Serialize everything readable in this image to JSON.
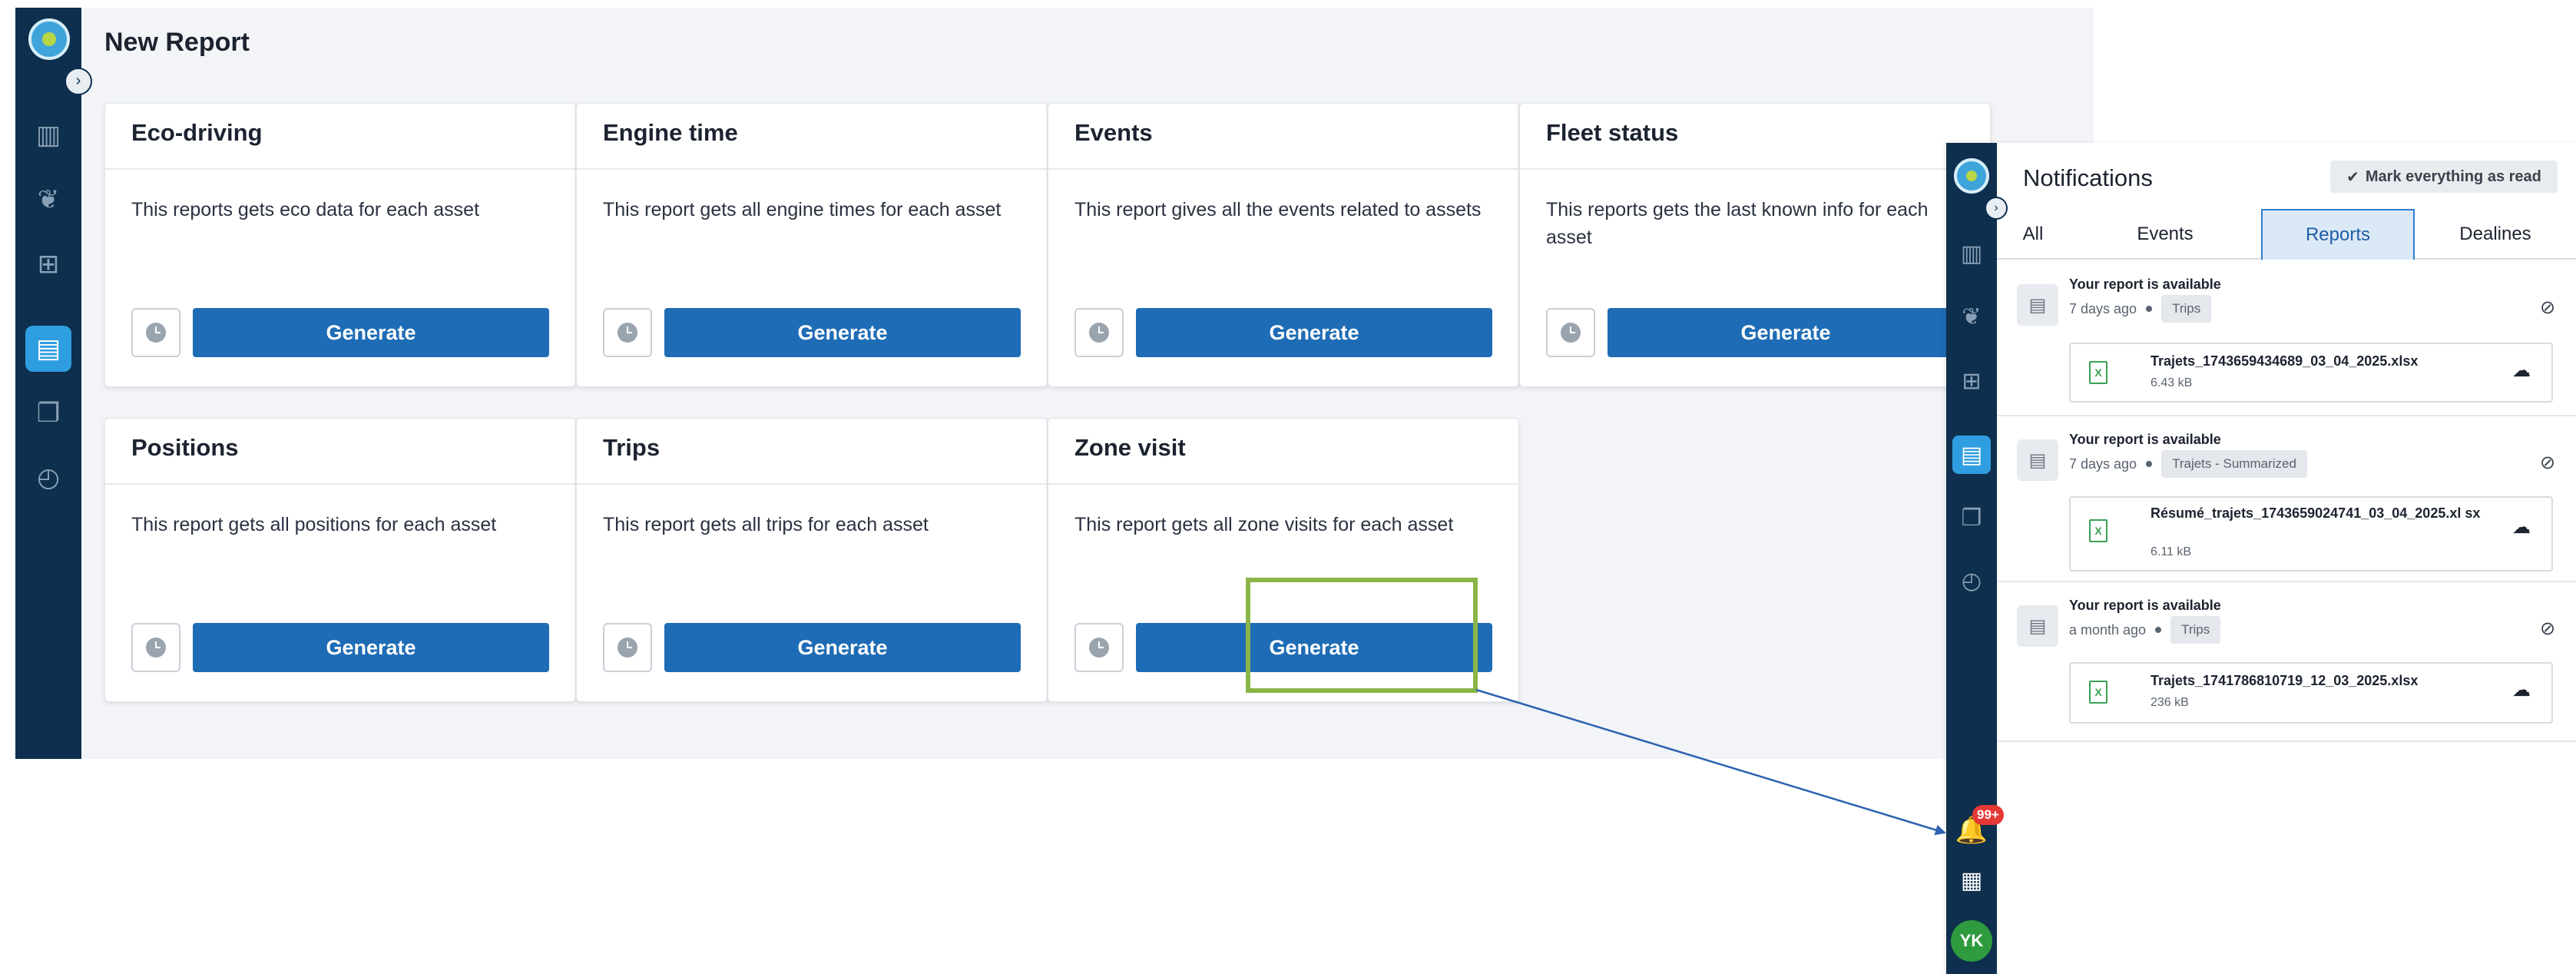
{
  "main": {
    "page_title": "New Report",
    "cards": [
      {
        "title": "Eco-driving",
        "description": "This reports gets eco data for each asset",
        "button": "Generate"
      },
      {
        "title": "Engine time",
        "description": "This report gets all engine times for each asset",
        "button": "Generate"
      },
      {
        "title": "Events",
        "description": "This report gives all the events related to assets",
        "button": "Generate"
      },
      {
        "title": "Fleet status",
        "description": "This reports gets the last known info for each asset",
        "button": "Generate"
      },
      {
        "title": "Positions",
        "description": "This report gets all positions for each asset",
        "button": "Generate"
      },
      {
        "title": "Trips",
        "description": "This report gets all trips for each asset",
        "button": "Generate"
      },
      {
        "title": "Zone visit",
        "description": "This report gets all zone visits for each asset",
        "button": "Generate"
      }
    ]
  },
  "sidebar": {
    "toggle_glyph": "›",
    "items": [
      {
        "icon": "map-icon",
        "glyph": "▥"
      },
      {
        "icon": "leaf-icon",
        "glyph": "❦"
      },
      {
        "icon": "fleet-icon",
        "glyph": "⊞"
      },
      {
        "icon": "report-icon",
        "glyph": "▤",
        "active": true
      },
      {
        "icon": "documents-icon",
        "glyph": "❐"
      },
      {
        "icon": "scheduled-report-icon",
        "glyph": "◴"
      }
    ]
  },
  "notifications": {
    "title": "Notifications",
    "mark_all_read": "Mark everything as read",
    "tabs": [
      "All",
      "Events",
      "Reports",
      "Dealines"
    ],
    "active_tab": "Reports",
    "badge": "99+",
    "user_initials": "YK",
    "items": [
      {
        "title": "Your report is available",
        "time": "7 days ago",
        "tag": "Trips",
        "file_name": "Trajets_1743659434689_03_04_2025.xlsx",
        "file_size": "6.43 kB"
      },
      {
        "title": "Your report is available",
        "time": "7 days ago",
        "tag": "Trajets - Summarized",
        "file_name": "Résumé_trajets_1743659024741_03_04_2025.xl sx",
        "file_size": "6.11 kB"
      },
      {
        "title": "Your report is available",
        "time": "a month ago",
        "tag": "Trips",
        "file_name": "Trajets_1741786810719_12_03_2025.xlsx",
        "file_size": "236 kB"
      }
    ]
  },
  "colors": {
    "sidebar": "#0e2f4d",
    "primary_button": "#1e6cb5",
    "highlight_box": "#8bb548",
    "active_nav": "#2f9ee0",
    "badge": "#e53935",
    "avatar": "#2e9b3f"
  }
}
